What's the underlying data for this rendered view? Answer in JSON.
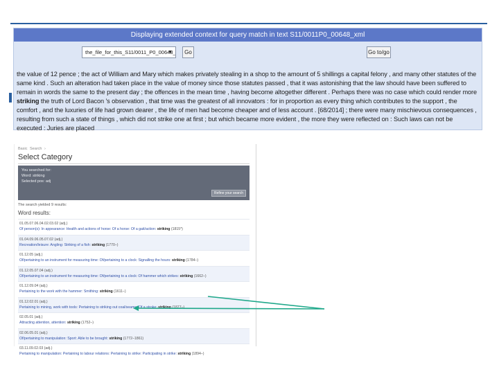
{
  "context_panel": {
    "title": "Displaying extended context for query match in text S11/0011P0_00648_xml",
    "file_select_value": "the_file_for_this_S11/0011_P0_00648_xml",
    "go_label": "Go",
    "goto_label": "Go to/go",
    "text_before_1": "the value of 12 pence ; the act of William and Mary which makes privately stealing in a shop to the amount of 5 shillings a capital felony , and many other statutes of the same kind . Such an alteration had taken place in the value of money since those statutes passed , that it was astonishing that the law should have been suffered to remain in words the same to the present day ; the offences in the mean time , having become altogether different . Perhaps there was no case which could render more ",
    "hit_word": "striking",
    "text_after_1": " the truth of Lord Bacon 's observation , that time was the greatest of all innovators : for in proportion as every thing which contributes to the support , the comfort , and the luxuries of life had grown dearer , the life of men had become cheaper and of less account . [68/2014] ; there were many mischievous consequences , resulting from such a state of things , which did not strike one at first ; but which became more evident , the more they were reflected on : Such laws can not be executed : Juries are placed"
  },
  "search_panel": {
    "crumbs": [
      "Basic",
      "Search",
      "›"
    ],
    "title": "Select Category",
    "searched_for_label": "You searched for:",
    "word_line": "Word: striking",
    "pos_line": "Selected pos: adj",
    "refine_label": "Refine your search",
    "results_label": "The search yielded 9 results:",
    "word_results_label": "Word results:",
    "results": [
      {
        "code": "01.05.07.06.04.02.03.02 (adj.)",
        "path": "Of person(s): In appearance: Health and actions of horse: Of a horse: Of a gait/action:",
        "word": "striking",
        "date": "(1815*)"
      },
      {
        "code": "01.04.09.06.05.07.02 (adj.)",
        "path": "Recreation/leisure: Angling: Striking of a fish:",
        "word": "striking",
        "date": "(1770–)"
      },
      {
        "code": "01.12.05 (adj.)",
        "path": "Of/pertaining to an instrument for measuring time: Of/pertaining to a clock: Signalling the hours:",
        "word": "striking",
        "date": "(1784–)"
      },
      {
        "code": "01.12.05.07.04 (adj.)",
        "path": "Of/pertaining to an instrument for measuring time: Of/pertaining to a clock: Of hammer which strikes:",
        "word": "striking",
        "date": "(1662–)"
      },
      {
        "code": "01.12.09.04 (adj.)",
        "path": "Pertaining to the work with the hammer: Smithing:",
        "word": "striking",
        "date": "(1611–)"
      },
      {
        "code": "01.12.02.01 (adj.)",
        "path": "Pertaining to mining, work with tools: Pertaining to striking out coal/seams: Of a stroke:",
        "word": "striking",
        "date": "(1877–)"
      },
      {
        "code": "02.05.01 (adj.)",
        "path": "Attracting attention, attention:",
        "word": "striking",
        "date": "(1752–)"
      },
      {
        "code": "02.06.05.01 (adj.)",
        "path": "Of/pertaining to manipulation: Sport: Able to be brought:",
        "word": "striking",
        "date": "(1772–1861)"
      },
      {
        "code": "03.11.09.02.03 (adj.)",
        "path": "Pertaining to manipulation: Pertaining to labour relations: Pertaining to strike: Participating in strike:",
        "word": "striking",
        "date": "(1894–)"
      }
    ]
  },
  "colors": {
    "panel_bg": "#dde6f5",
    "title_bar": "#5c78c8",
    "search_box": "#636a78",
    "arrow": "#1fa88a"
  }
}
